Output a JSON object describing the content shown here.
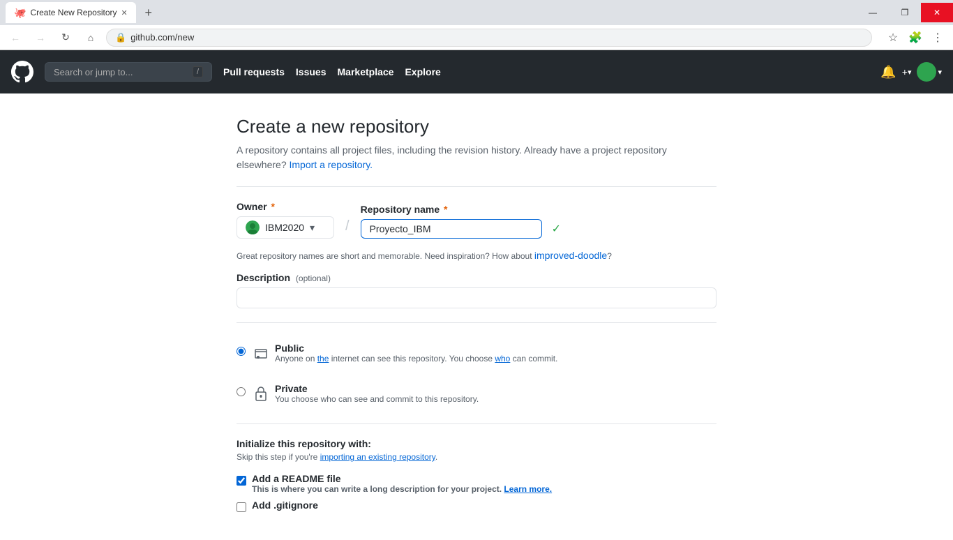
{
  "browser": {
    "tab_title": "Create New Repository",
    "url": "github.com/new",
    "new_tab_icon": "+",
    "back_disabled": false,
    "forward_disabled": true,
    "window_controls": {
      "minimize": "—",
      "maximize": "❐",
      "close": "✕"
    }
  },
  "header": {
    "search_placeholder": "Search or jump to...",
    "search_kbd": "/",
    "nav_items": [
      "Pull requests",
      "Issues",
      "Marketplace",
      "Explore"
    ],
    "plus_label": "+",
    "chevron": "▾"
  },
  "page": {
    "title": "Create a new repository",
    "subtitle": "A repository contains all project files, including the revision history. Already have a project repository elsewhere?",
    "import_link": "Import a repository.",
    "owner_label": "Owner",
    "owner_required": "*",
    "owner_value": "IBM2020",
    "owner_chevron": "▾",
    "repo_name_label": "Repository name",
    "repo_name_required": "*",
    "repo_name_value": "Proyecto_IBM",
    "repo_name_valid": "✓",
    "slash": "/",
    "hint": "Great repository names are short and memorable. Need inspiration? How about ",
    "hint_suggestion": "improved-doodle",
    "hint_end": "?",
    "description_label": "Description",
    "description_optional": "(optional)",
    "description_placeholder": "",
    "public_label": "Public",
    "public_desc": "Anyone on the internet can see this repository. You choose who can commit.",
    "public_desc_link_text": "the",
    "private_label": "Private",
    "private_desc": "You choose who can see and commit to this repository.",
    "init_title": "Initialize this repository with:",
    "init_subtitle": "Skip this step if you're importing an existing repository.",
    "init_subtitle_link": "importing an existing repository",
    "readme_label": "Add a README file",
    "readme_desc": "This is where you can write a long description for your project.",
    "readme_desc_link": "Learn more.",
    "gitignore_label": "Add .gitignore"
  }
}
